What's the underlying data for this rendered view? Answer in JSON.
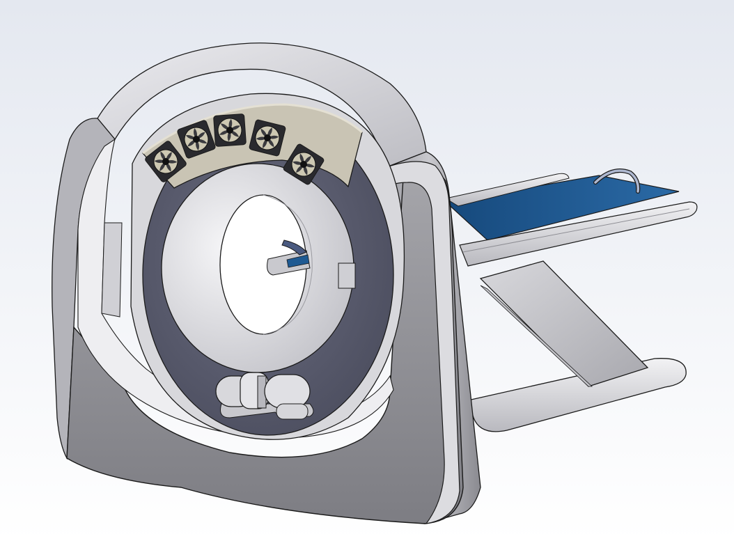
{
  "viewport": {
    "background_top": "#e4e8f0",
    "background_bottom": "#ffffff"
  },
  "model": {
    "gantry_color": "#d4d4d8",
    "gantry_shadow_color": "#8f8f94",
    "inner_ring_color": "#5b5d6e",
    "bore_color": "#e6e6ea",
    "fan_mount_color": "#c9c4b4",
    "couch_pad_color": "#1f5a92",
    "couch_rail_color": "#d6d6da",
    "outline_color": "#1a1a1a",
    "fan_count": 5
  }
}
